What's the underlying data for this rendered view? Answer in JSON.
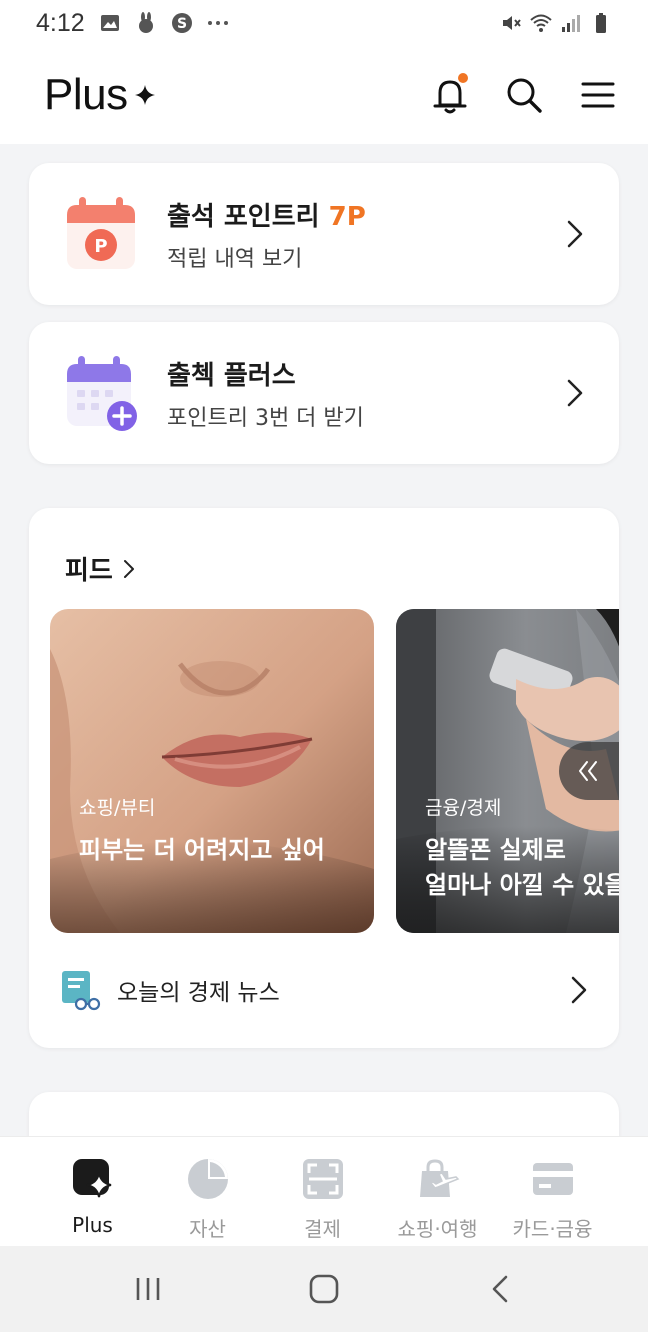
{
  "status_bar": {
    "time": "4:12"
  },
  "header": {
    "logo_text": "Plus"
  },
  "promo_cards": [
    {
      "title": "출석 포인트리",
      "highlight": "7P",
      "subtitle": "적립 내역 보기"
    },
    {
      "title": "출첵 플러스",
      "highlight": "",
      "subtitle": "포인트리 3번 더 받기"
    }
  ],
  "feed": {
    "title": "피드",
    "items": [
      {
        "tag": "쇼핑/뷰티",
        "headline": "피부는 더 어려지고 싶어"
      },
      {
        "tag": "금융/경제",
        "headline": "알뜰폰 실제로\n얼마나 아낄 수 있을"
      }
    ],
    "news_label": "오늘의 경제 뉴스"
  },
  "tabs": [
    {
      "label": "Plus",
      "icon": "plus-sparkle-icon",
      "active": true
    },
    {
      "label": "자산",
      "icon": "pie-chart-icon",
      "active": false
    },
    {
      "label": "결제",
      "icon": "scan-icon",
      "active": false
    },
    {
      "label": "쇼핑·여행",
      "icon": "shopping-travel-icon",
      "active": false
    },
    {
      "label": "카드·금융",
      "icon": "card-icon",
      "active": false
    }
  ],
  "colors": {
    "accent": "#f07524",
    "active_tab": "#1b1b1b",
    "inactive_tab": "#9a9a9a"
  }
}
